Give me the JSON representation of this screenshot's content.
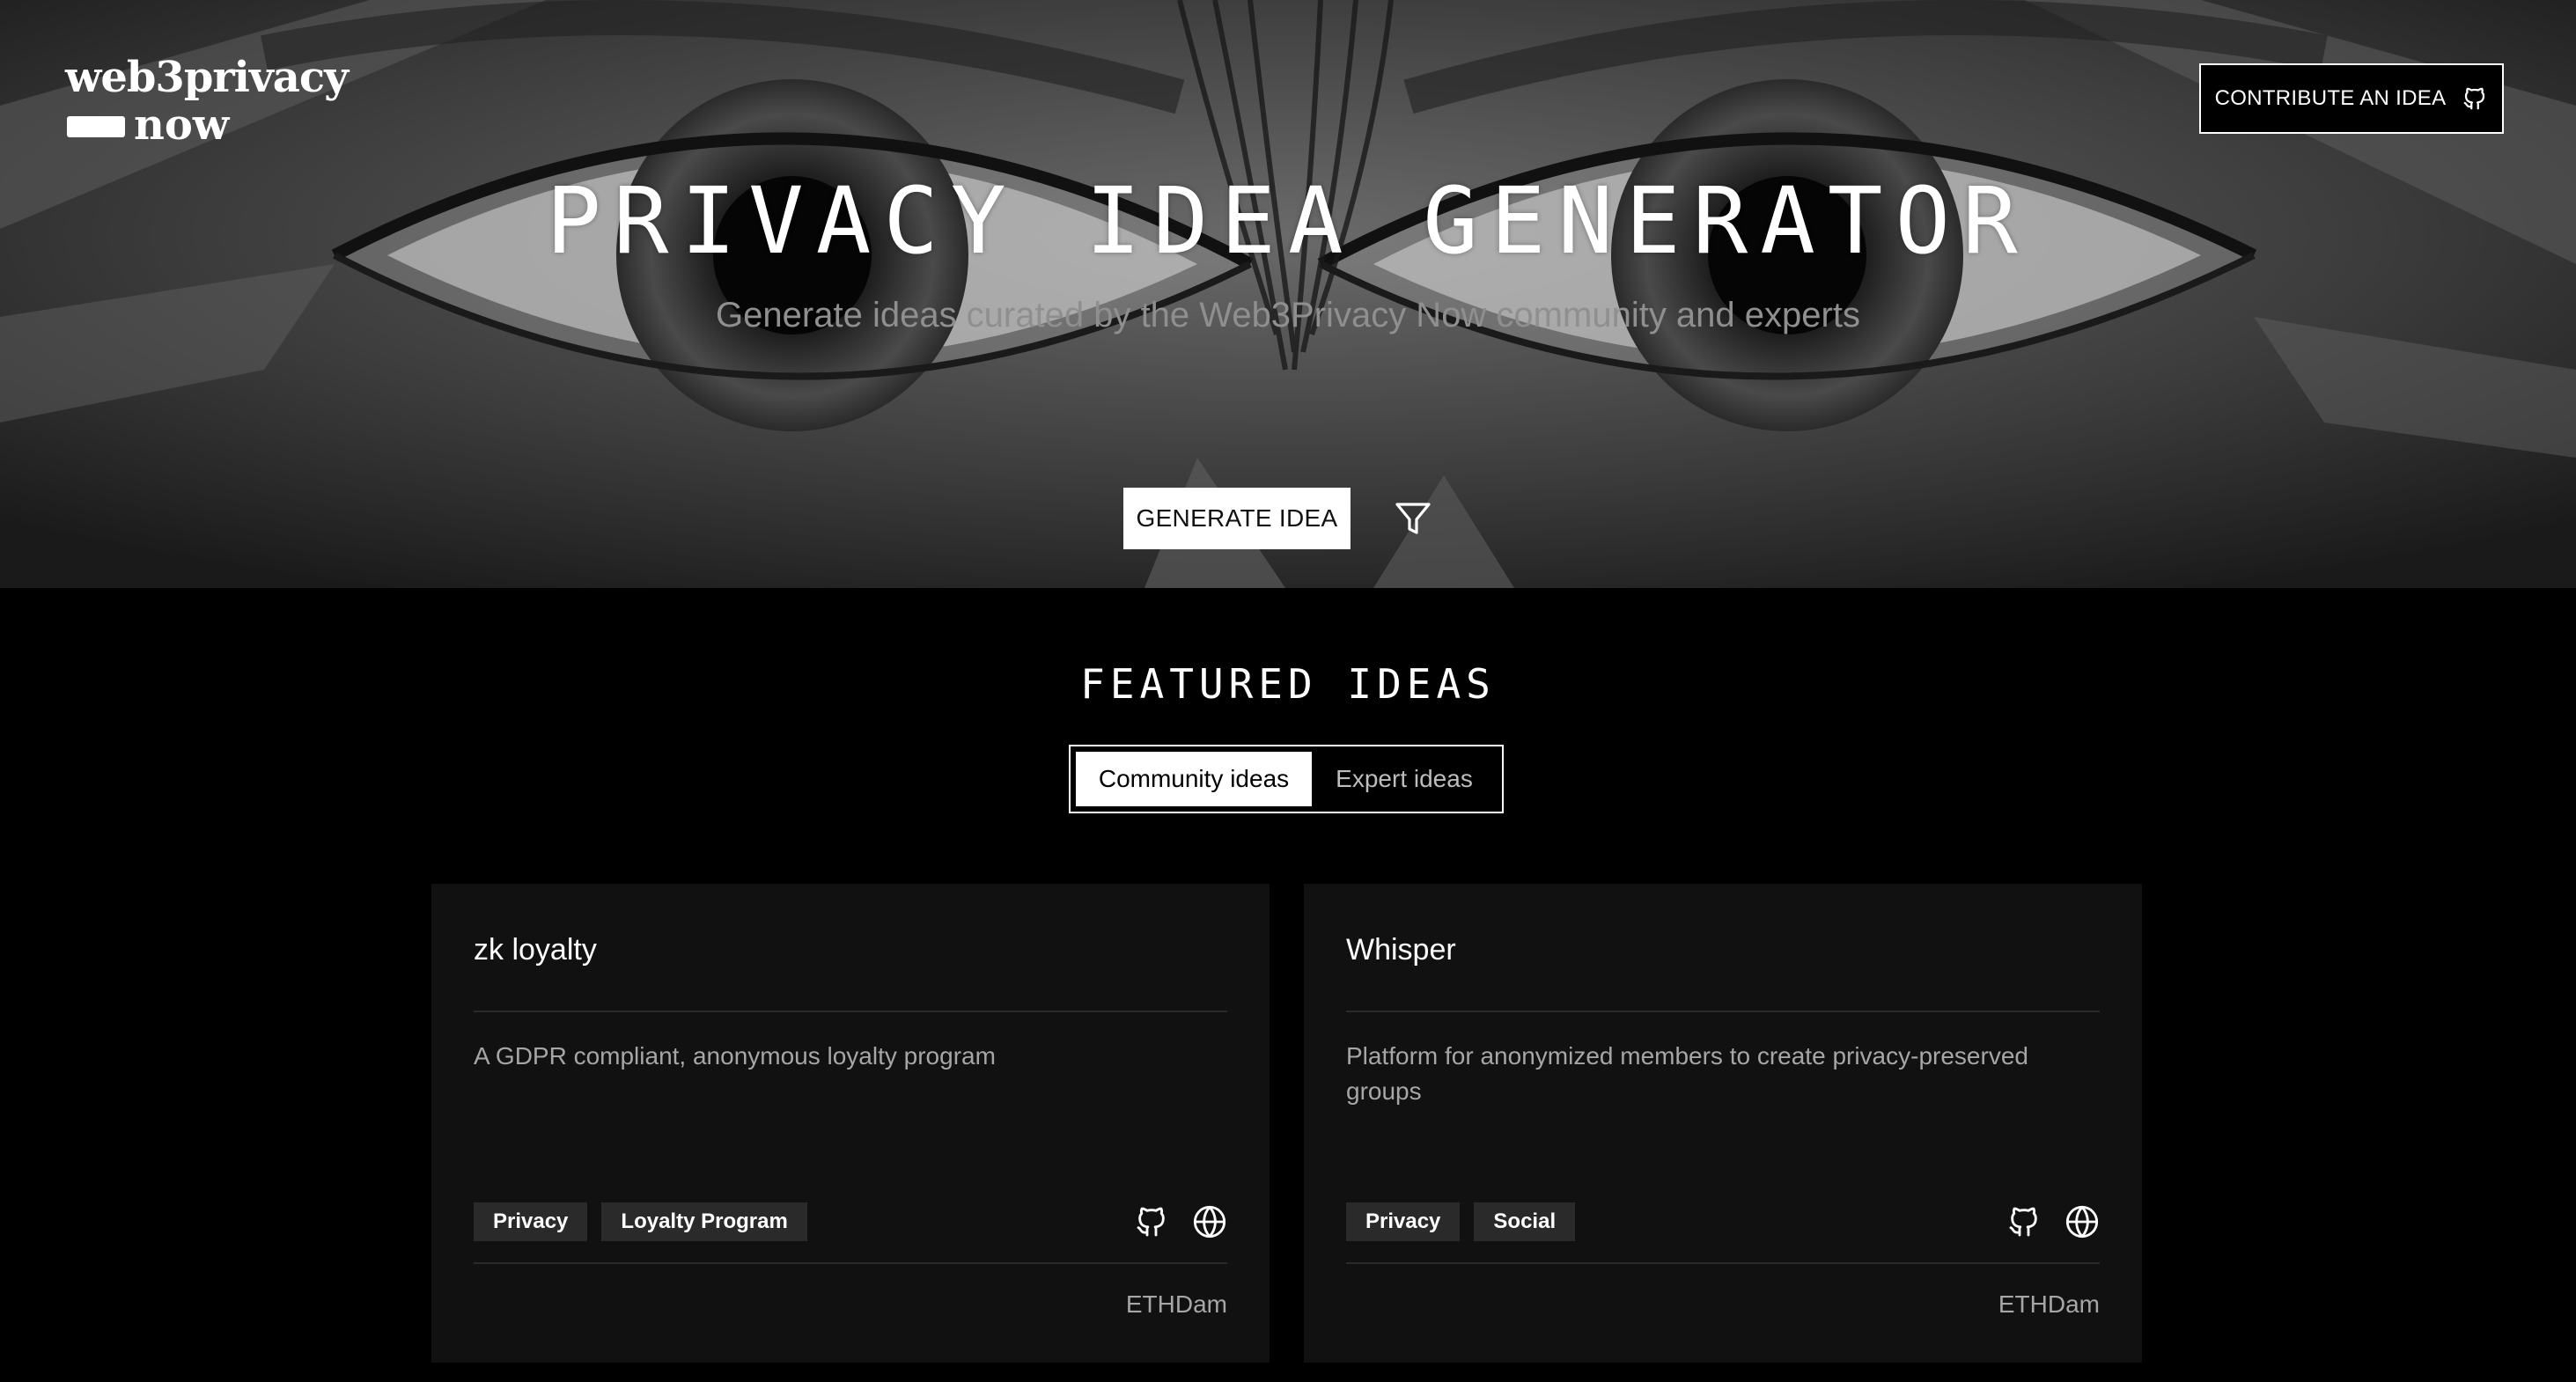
{
  "header": {
    "logo_line1": "web3privacy",
    "logo_line2": "now",
    "contribute_label": "CONTRIBUTE AN IDEA",
    "contribute_icon": "github-icon"
  },
  "hero": {
    "title": "PRIVACY IDEA GENERATOR",
    "subtitle": "Generate ideas curated by the Web3Privacy Now community and experts",
    "generate_label": "GENERATE IDEA",
    "filter_icon": "filter-icon"
  },
  "featured": {
    "heading": "FEATURED IDEAS",
    "tabs": [
      {
        "label": "Community ideas",
        "active": true
      },
      {
        "label": "Expert ideas",
        "active": false
      }
    ]
  },
  "cards": [
    {
      "title": "zk loyalty",
      "description": "A GDPR compliant, anonymous loyalty program",
      "tags": [
        "Privacy",
        "Loyalty Program"
      ],
      "icons": [
        "github-icon",
        "globe-icon"
      ],
      "event": "ETHDam"
    },
    {
      "title": "Whisper",
      "description": "Platform for anonymized members to create privacy-preserved groups",
      "tags": [
        "Privacy",
        "Social"
      ],
      "icons": [
        "github-icon",
        "globe-icon"
      ],
      "event": "ETHDam"
    }
  ],
  "colors": {
    "background": "#000000",
    "card": "#111111",
    "tag": "#2a2a2a",
    "muted_text": "#a6a6a6"
  }
}
